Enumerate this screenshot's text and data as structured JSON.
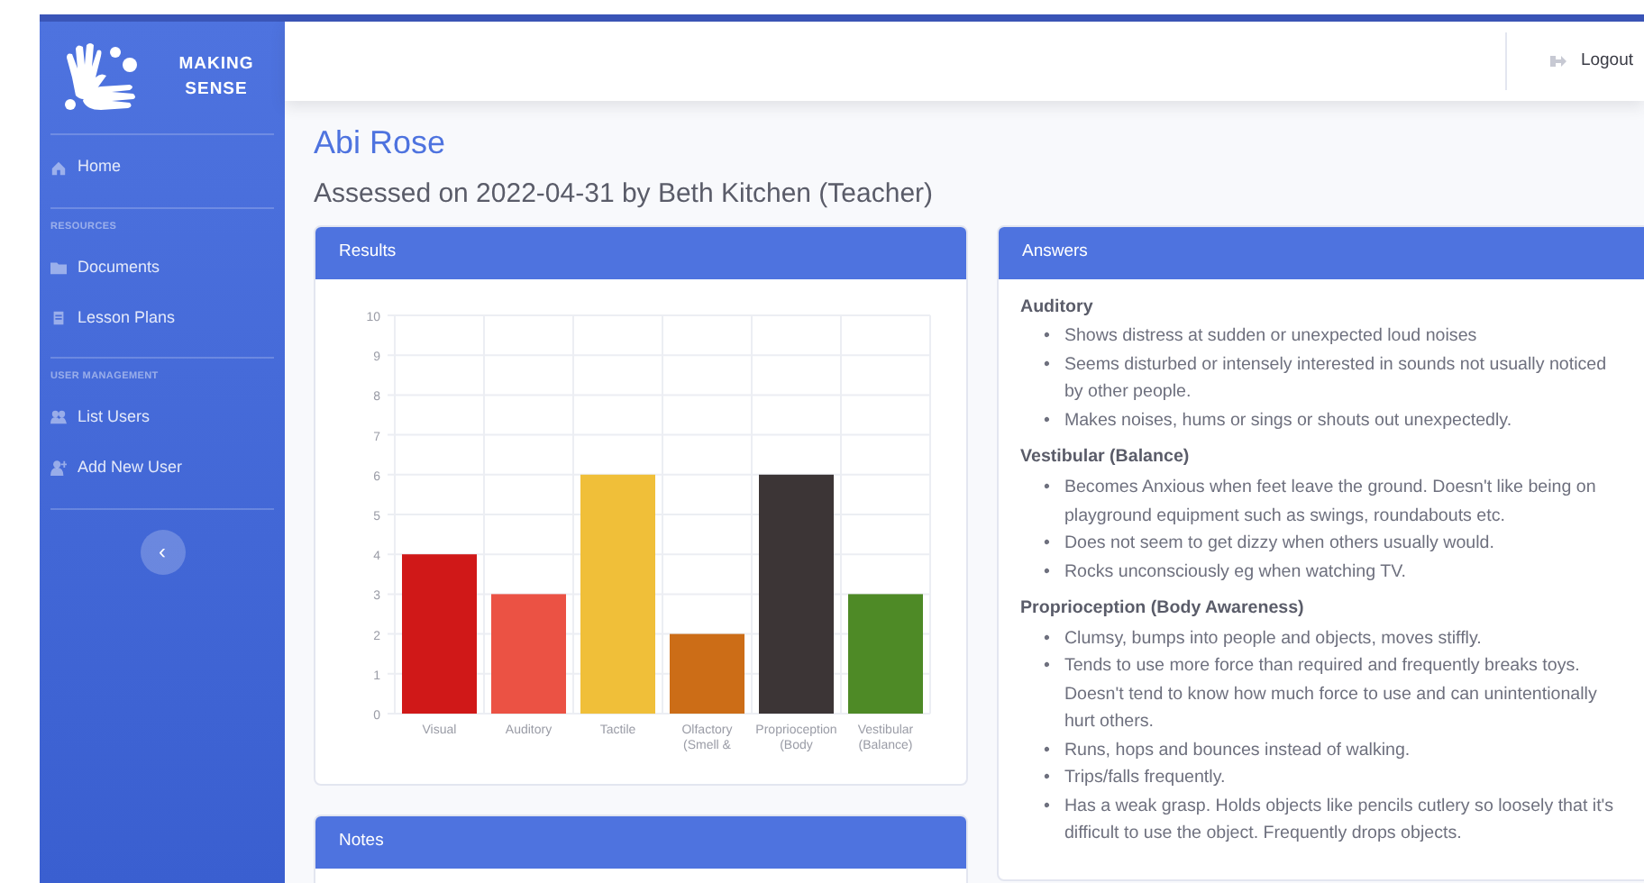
{
  "sidebar": {
    "brand": "MAKING SENSE",
    "items": [
      {
        "kind": "link",
        "label": "Home"
      },
      {
        "kind": "heading",
        "label": "RESOURCES"
      },
      {
        "kind": "link",
        "label": "Documents"
      },
      {
        "kind": "link",
        "label": "Lesson Plans"
      },
      {
        "kind": "heading",
        "label": "USER MANAGEMENT"
      },
      {
        "kind": "link",
        "label": "List Users"
      },
      {
        "kind": "link",
        "label": "Add New User"
      }
    ],
    "toggle": "‹"
  },
  "topbar": {
    "logout": "Logout"
  },
  "page": {
    "title": "Abi Rose",
    "subtitle": "Assessed on 2022-04-31 by Beth Kitchen (Teacher)"
  },
  "results": {
    "title": "Results",
    "chart_data": {
      "type": "bar",
      "categories": [
        "Visual",
        "Auditory",
        "Tactile",
        "Olfactory (Smell &",
        "Proprioception (Body",
        "Vestibular (Balance)"
      ],
      "values": [
        4,
        3,
        6,
        2,
        6,
        3
      ],
      "grid": true,
      "colors": [
        "#d01818",
        "#eb5244",
        "#f0bf39",
        "#cc6d17",
        "#3c3536",
        "#4e8a26"
      ],
      "ylim": [
        0,
        10
      ],
      "yticks": [
        0,
        1,
        2,
        3,
        4,
        5,
        6,
        7,
        8,
        9,
        10
      ]
    }
  },
  "notes": {
    "title": "Notes"
  },
  "answers": {
    "title": "Answers",
    "bullet": "•",
    "sections": [
      {
        "heading": "Auditory",
        "items": [
          "Shows distress at sudden or unexpected loud noises",
          "Seems disturbed or intensely interested in sounds not usually noticed by other people.",
          "Makes noises, hums or sings or shouts out unexpectedly."
        ]
      },
      {
        "heading": "Vestibular (Balance)",
        "items": [
          "Becomes Anxious when feet leave the ground. Doesn't like being on playground equipment such as swings, roundabouts etc.",
          "Does not seem to get dizzy when others usually would.",
          "Rocks unconsciously eg when watching TV."
        ]
      },
      {
        "heading": "Proprioception (Body Awareness)",
        "items": [
          "Clumsy, bumps into people and objects, moves stiffly.",
          "Tends to use more force than required and frequently breaks toys. Doesn't tend to know how much force to use and can unintentionally hurt others.",
          "Runs, hops and bounces instead of walking.",
          "Trips/falls frequently.",
          "Has a weak grasp. Holds objects like pencils cutlery so loosely that it's difficult to use the object. Frequently drops objects."
        ]
      }
    ]
  }
}
